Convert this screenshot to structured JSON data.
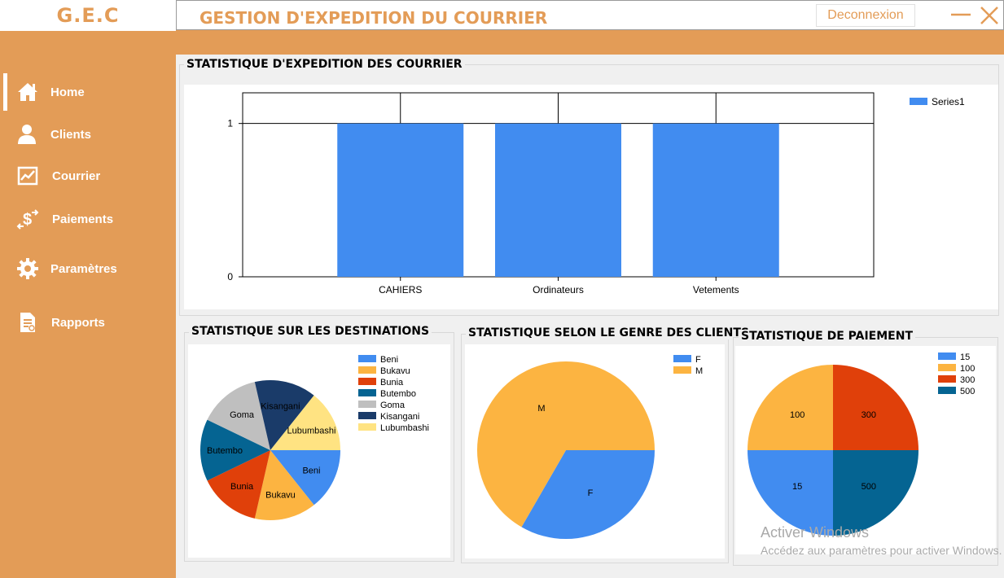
{
  "brand": "G.E.C",
  "header": {
    "title": "GESTION D'EXPEDITION DU COURRIER",
    "logout_label": "Deconnexion"
  },
  "sidebar": {
    "items": [
      {
        "label": "Home",
        "icon": "home-icon"
      },
      {
        "label": "Clients",
        "icon": "user-icon"
      },
      {
        "label": "Courrier",
        "icon": "chart-icon"
      },
      {
        "label": "Paiements",
        "icon": "dollar-transfer-icon"
      },
      {
        "label": "Paramètres",
        "icon": "gear-icon"
      },
      {
        "label": "Rapports",
        "icon": "report-icon"
      }
    ]
  },
  "panels": {
    "expedition": "STATISTIQUE D'EXPEDITION DES COURRIER",
    "destinations": "STATISTIQUE SUR LES DESTINATIONS",
    "genre": "STATISTIQUE SELON LE GENRE DES CLIENTS",
    "paiement": "STATISTIQUE DE PAIEMENT"
  },
  "watermark": {
    "line1": "Activer Windows",
    "line2": "Accédez aux paramètres pour activer Windows."
  },
  "chart_data": [
    {
      "type": "bar",
      "categories": [
        "CAHIERS",
        "Ordinateurs",
        "Vetements"
      ],
      "series": [
        {
          "name": "Series1",
          "values": [
            1,
            1,
            1
          ],
          "color": "#418cf0"
        }
      ],
      "ylim": [
        0,
        1.2
      ],
      "yticks": [
        0,
        1
      ],
      "legend": "top-right"
    },
    {
      "type": "pie",
      "labels": [
        "Beni",
        "Bukavu",
        "Bunia",
        "Butembo",
        "Goma",
        "Kisangani",
        "Lubumbashi"
      ],
      "values": [
        1,
        1,
        1,
        1,
        1,
        1,
        1
      ],
      "colors": [
        "#418cf0",
        "#fcb441",
        "#e0400a",
        "#056492",
        "#bfbfbf",
        "#1a3b69",
        "#ffe382"
      ],
      "legend": "top-right"
    },
    {
      "type": "pie",
      "labels": [
        "F",
        "M"
      ],
      "values": [
        1,
        2
      ],
      "colors": [
        "#418cf0",
        "#fcb441"
      ],
      "legend": "top-right"
    },
    {
      "type": "pie",
      "labels": [
        "15",
        "100",
        "300",
        "500"
      ],
      "values": [
        1,
        1,
        1,
        1
      ],
      "colors": [
        "#418cf0",
        "#fcb441",
        "#e0400a",
        "#056492"
      ],
      "legend": "top-right"
    }
  ]
}
